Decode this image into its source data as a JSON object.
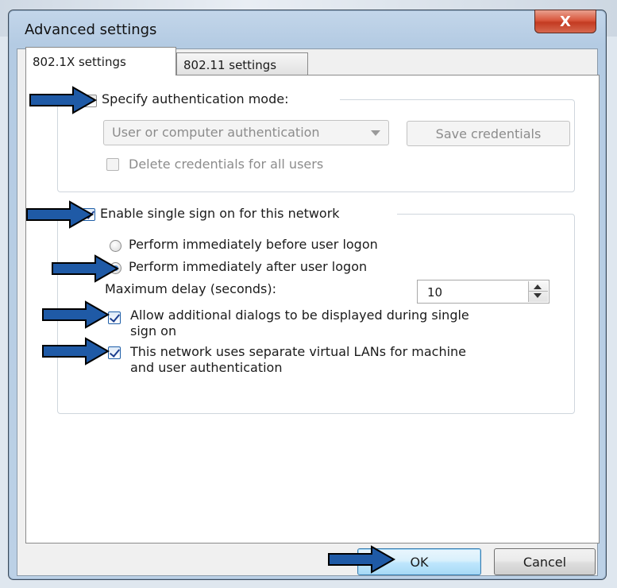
{
  "window": {
    "title": "Advanced settings",
    "close_glyph": "X"
  },
  "tabs": [
    {
      "label": "802.1X settings",
      "active": true
    },
    {
      "label": "802.11 settings",
      "active": false
    }
  ],
  "auth_group": {
    "specify_label": "Specify authentication mode:",
    "specify_checked": false,
    "mode_value": "User or computer authentication",
    "save_credentials_label": "Save credentials",
    "delete_credentials_label": "Delete credentials for all users"
  },
  "sso_group": {
    "enable_label": "Enable single sign on for this network",
    "enable_checked": true,
    "radio_before_label": "Perform immediately before user logon",
    "radio_after_label": "Perform immediately after user logon",
    "selected_radio": "after",
    "max_delay_label": "Maximum delay (seconds):",
    "max_delay_value": "10",
    "allow_dialogs_line1": "Allow additional dialogs to be displayed during single",
    "allow_dialogs_line2": "sign on",
    "allow_dialogs_checked": true,
    "vlan_line1": "This network uses separate virtual LANs for machine",
    "vlan_line2": "and user authentication",
    "vlan_checked": true
  },
  "footer": {
    "ok_label": "OK",
    "cancel_label": "Cancel"
  },
  "colors": {
    "annotation_arrow_fill": "#1f5aa6",
    "annotation_arrow_stroke": "#000000",
    "accent": "#1d58b4"
  },
  "icons": {
    "annotation": "arrow-right-icon",
    "spin_up": "spin-up-icon",
    "spin_down": "spin-down-icon",
    "dropdown": "chevron-down-icon"
  }
}
